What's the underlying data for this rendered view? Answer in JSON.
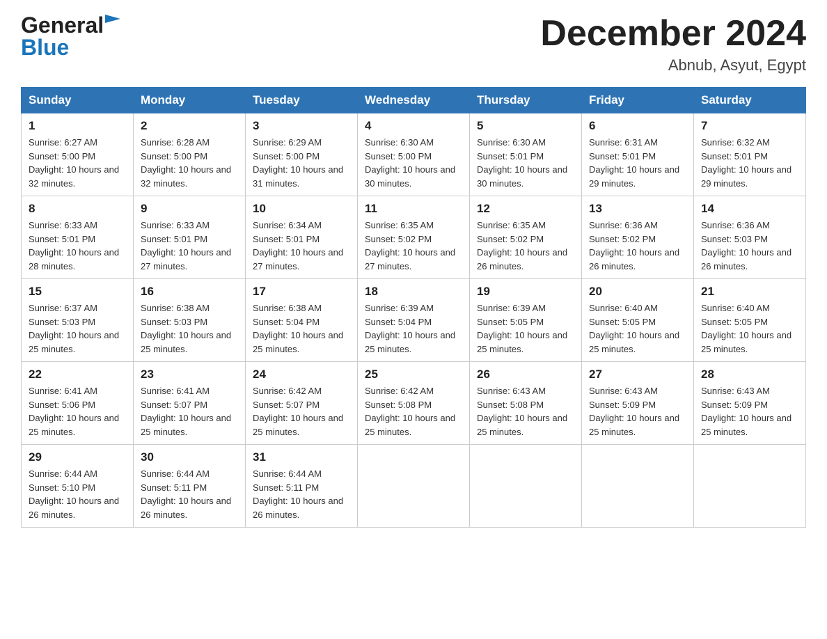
{
  "header": {
    "logo_line1": "General",
    "logo_line2": "Blue",
    "month_title": "December 2024",
    "location": "Abnub, Asyut, Egypt"
  },
  "days_of_week": [
    "Sunday",
    "Monday",
    "Tuesday",
    "Wednesday",
    "Thursday",
    "Friday",
    "Saturday"
  ],
  "weeks": [
    [
      {
        "day": "1",
        "sunrise": "6:27 AM",
        "sunset": "5:00 PM",
        "daylight": "10 hours and 32 minutes."
      },
      {
        "day": "2",
        "sunrise": "6:28 AM",
        "sunset": "5:00 PM",
        "daylight": "10 hours and 32 minutes."
      },
      {
        "day": "3",
        "sunrise": "6:29 AM",
        "sunset": "5:00 PM",
        "daylight": "10 hours and 31 minutes."
      },
      {
        "day": "4",
        "sunrise": "6:30 AM",
        "sunset": "5:00 PM",
        "daylight": "10 hours and 30 minutes."
      },
      {
        "day": "5",
        "sunrise": "6:30 AM",
        "sunset": "5:01 PM",
        "daylight": "10 hours and 30 minutes."
      },
      {
        "day": "6",
        "sunrise": "6:31 AM",
        "sunset": "5:01 PM",
        "daylight": "10 hours and 29 minutes."
      },
      {
        "day": "7",
        "sunrise": "6:32 AM",
        "sunset": "5:01 PM",
        "daylight": "10 hours and 29 minutes."
      }
    ],
    [
      {
        "day": "8",
        "sunrise": "6:33 AM",
        "sunset": "5:01 PM",
        "daylight": "10 hours and 28 minutes."
      },
      {
        "day": "9",
        "sunrise": "6:33 AM",
        "sunset": "5:01 PM",
        "daylight": "10 hours and 27 minutes."
      },
      {
        "day": "10",
        "sunrise": "6:34 AM",
        "sunset": "5:01 PM",
        "daylight": "10 hours and 27 minutes."
      },
      {
        "day": "11",
        "sunrise": "6:35 AM",
        "sunset": "5:02 PM",
        "daylight": "10 hours and 27 minutes."
      },
      {
        "day": "12",
        "sunrise": "6:35 AM",
        "sunset": "5:02 PM",
        "daylight": "10 hours and 26 minutes."
      },
      {
        "day": "13",
        "sunrise": "6:36 AM",
        "sunset": "5:02 PM",
        "daylight": "10 hours and 26 minutes."
      },
      {
        "day": "14",
        "sunrise": "6:36 AM",
        "sunset": "5:03 PM",
        "daylight": "10 hours and 26 minutes."
      }
    ],
    [
      {
        "day": "15",
        "sunrise": "6:37 AM",
        "sunset": "5:03 PM",
        "daylight": "10 hours and 25 minutes."
      },
      {
        "day": "16",
        "sunrise": "6:38 AM",
        "sunset": "5:03 PM",
        "daylight": "10 hours and 25 minutes."
      },
      {
        "day": "17",
        "sunrise": "6:38 AM",
        "sunset": "5:04 PM",
        "daylight": "10 hours and 25 minutes."
      },
      {
        "day": "18",
        "sunrise": "6:39 AM",
        "sunset": "5:04 PM",
        "daylight": "10 hours and 25 minutes."
      },
      {
        "day": "19",
        "sunrise": "6:39 AM",
        "sunset": "5:05 PM",
        "daylight": "10 hours and 25 minutes."
      },
      {
        "day": "20",
        "sunrise": "6:40 AM",
        "sunset": "5:05 PM",
        "daylight": "10 hours and 25 minutes."
      },
      {
        "day": "21",
        "sunrise": "6:40 AM",
        "sunset": "5:05 PM",
        "daylight": "10 hours and 25 minutes."
      }
    ],
    [
      {
        "day": "22",
        "sunrise": "6:41 AM",
        "sunset": "5:06 PM",
        "daylight": "10 hours and 25 minutes."
      },
      {
        "day": "23",
        "sunrise": "6:41 AM",
        "sunset": "5:07 PM",
        "daylight": "10 hours and 25 minutes."
      },
      {
        "day": "24",
        "sunrise": "6:42 AM",
        "sunset": "5:07 PM",
        "daylight": "10 hours and 25 minutes."
      },
      {
        "day": "25",
        "sunrise": "6:42 AM",
        "sunset": "5:08 PM",
        "daylight": "10 hours and 25 minutes."
      },
      {
        "day": "26",
        "sunrise": "6:43 AM",
        "sunset": "5:08 PM",
        "daylight": "10 hours and 25 minutes."
      },
      {
        "day": "27",
        "sunrise": "6:43 AM",
        "sunset": "5:09 PM",
        "daylight": "10 hours and 25 minutes."
      },
      {
        "day": "28",
        "sunrise": "6:43 AM",
        "sunset": "5:09 PM",
        "daylight": "10 hours and 25 minutes."
      }
    ],
    [
      {
        "day": "29",
        "sunrise": "6:44 AM",
        "sunset": "5:10 PM",
        "daylight": "10 hours and 26 minutes."
      },
      {
        "day": "30",
        "sunrise": "6:44 AM",
        "sunset": "5:11 PM",
        "daylight": "10 hours and 26 minutes."
      },
      {
        "day": "31",
        "sunrise": "6:44 AM",
        "sunset": "5:11 PM",
        "daylight": "10 hours and 26 minutes."
      },
      null,
      null,
      null,
      null
    ]
  ],
  "labels": {
    "sunrise_prefix": "Sunrise: ",
    "sunset_prefix": "Sunset: ",
    "daylight_prefix": "Daylight: "
  }
}
